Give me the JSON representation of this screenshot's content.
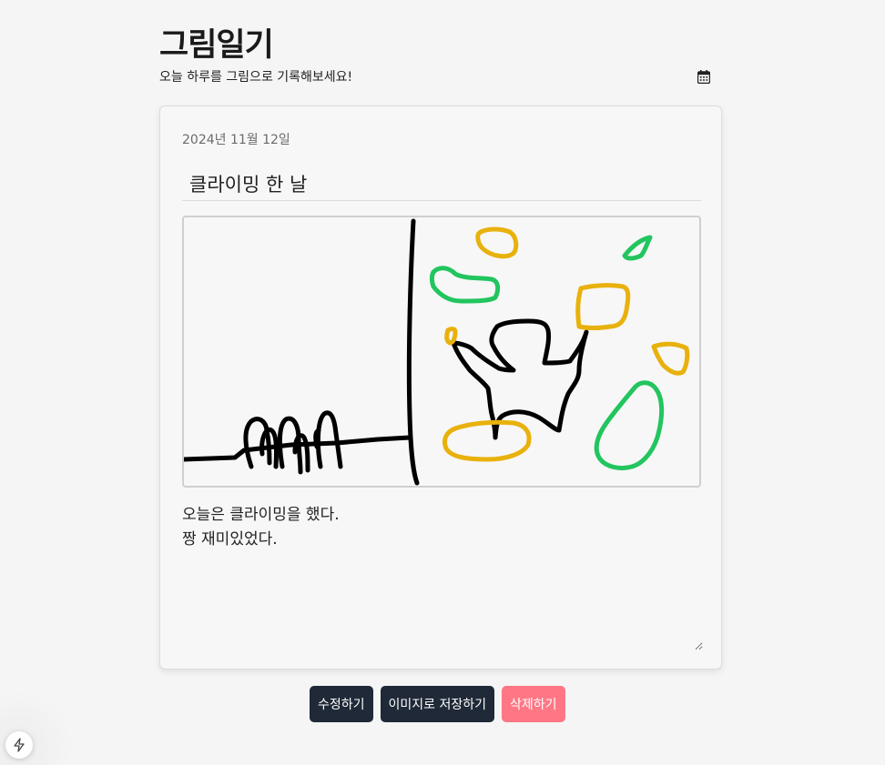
{
  "app": {
    "title": "그림일기",
    "subtitle": "오늘 하루를 그림으로 기록해보세요!"
  },
  "icons": {
    "calendar": "calendar-icon",
    "corner": "lightning-icon"
  },
  "entry": {
    "date": "2024년 11월 12일",
    "title": "클라이밍 한 날",
    "body": "오늘은 클라이밍을 했다.\n짱 재미있었다."
  },
  "drawing": {
    "stroke_colors": {
      "black": "#000000",
      "yellow": "#e8b10c",
      "green": "#22c55e"
    }
  },
  "actions": {
    "edit_label": "수정하기",
    "save_image_label": "이미지로 저장하기",
    "delete_label": "삭제하기"
  },
  "colors": {
    "dark_button": "#1f2937",
    "delete_button": "#ff7785",
    "background": "#f5f5f5"
  }
}
